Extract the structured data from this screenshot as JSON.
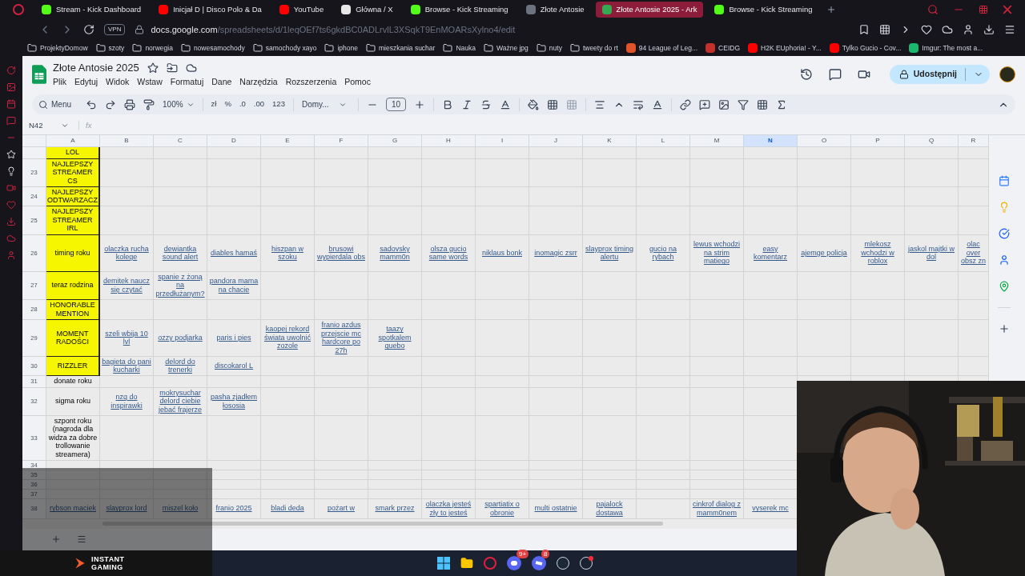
{
  "browser": {
    "tabs": [
      {
        "title": "Stream - Kick Dashboard",
        "color": "#53fc18",
        "selected": false
      },
      {
        "title": "Inicjał D | Disco Polo & Da",
        "color": "#ff0000",
        "selected": false
      },
      {
        "title": "YouTube",
        "color": "#ff0000",
        "selected": false
      },
      {
        "title": "Główna / X",
        "color": "#e7e7e7",
        "selected": false
      },
      {
        "title": "Browse - Kick Streaming",
        "color": "#53fc18",
        "selected": false
      },
      {
        "title": "Złote Antosie",
        "color": "#6b7280",
        "selected": false
      },
      {
        "title": "Złote Antosie 2025 - Ark",
        "color": "#34a853",
        "selected": true
      },
      {
        "title": "Browse - Kick Streaming",
        "color": "#53fc18",
        "selected": false
      }
    ],
    "vpn": "VPN",
    "url_host": "docs.google.com",
    "url_path": "/spreadsheets/d/1leqOEf7ts6gkdBC0ADLrvlL3XSqkT9EnMOARsXylno4/edit",
    "bookmarks": [
      {
        "title": "ProjektyDomow",
        "kind": "folder"
      },
      {
        "title": "szoty",
        "kind": "folder"
      },
      {
        "title": "norwegia",
        "kind": "folder"
      },
      {
        "title": "nowesamochody",
        "kind": "folder"
      },
      {
        "title": "samochody xayo",
        "kind": "folder"
      },
      {
        "title": "iphone",
        "kind": "folder"
      },
      {
        "title": "mieszkania suchar",
        "kind": "folder"
      },
      {
        "title": "Nauka",
        "kind": "folder"
      },
      {
        "title": "Ważne jpg",
        "kind": "folder"
      },
      {
        "title": "nuty",
        "kind": "folder"
      },
      {
        "title": "tweety do rt",
        "kind": "folder"
      },
      {
        "title": "94 League of Leg...",
        "kind": "site",
        "color": "#e0532b"
      },
      {
        "title": "CEIDG",
        "kind": "site",
        "color": "#c4302b"
      },
      {
        "title": "H2K EUphoria! - Y...",
        "kind": "site",
        "color": "#ff0000"
      },
      {
        "title": "Tylko Gucio - Cov...",
        "kind": "site",
        "color": "#ff0000"
      },
      {
        "title": "Imgur: The most a...",
        "kind": "site",
        "color": "#1bb76e"
      }
    ]
  },
  "sheet": {
    "title": "Złote Antosie 2025",
    "menu": [
      "Plik",
      "Edytuj",
      "Widok",
      "Wstaw",
      "Formatuj",
      "Dane",
      "Narzędzia",
      "Rozszerzenia",
      "Pomoc"
    ],
    "share": "Udostępnij",
    "toolbar": {
      "search": "Menu",
      "zoom": "100%",
      "currency": "zł",
      "percent": "%",
      "decrease_decimals": ".0",
      "increase_decimals": ".00",
      "number_format": "123",
      "font": "Domy...",
      "font_size": "10"
    },
    "name_box": "N42",
    "formula_label": "fx",
    "columns": [
      {
        "letter": "A",
        "selected": false
      },
      {
        "letter": "B",
        "selected": false
      },
      {
        "letter": "C",
        "selected": false
      },
      {
        "letter": "D",
        "selected": false
      },
      {
        "letter": "E",
        "selected": false
      },
      {
        "letter": "F",
        "selected": false
      },
      {
        "letter": "G",
        "selected": false
      },
      {
        "letter": "H",
        "selected": false
      },
      {
        "letter": "I",
        "selected": false
      },
      {
        "letter": "J",
        "selected": false
      },
      {
        "letter": "K",
        "selected": false
      },
      {
        "letter": "L",
        "selected": false
      },
      {
        "letter": "M",
        "selected": false
      },
      {
        "letter": "N",
        "selected": true
      },
      {
        "letter": "O",
        "selected": false
      },
      {
        "letter": "P",
        "selected": false
      },
      {
        "letter": "Q",
        "selected": false
      },
      {
        "letter": "R",
        "selected": false
      }
    ],
    "rows": [
      {
        "highlight": true,
        "cells": [
          {
            "text": "LOL",
            "link": false
          }
        ]
      },
      {
        "number": "23",
        "highlight": true,
        "cells": [
          {
            "text": "NAJLEPSZY STREAMER CS",
            "link": false
          }
        ]
      },
      {
        "number": "24",
        "highlight": true,
        "cells": [
          {
            "text": "NAJLEPSZY ODTWARZACZ",
            "link": false
          }
        ]
      },
      {
        "number": "25",
        "highlight": true,
        "cells": [
          {
            "text": "NAJLEPSZY STREAMER IRL",
            "link": false
          }
        ]
      },
      {
        "number": "26",
        "highlight": true,
        "cells": [
          {
            "text": "timing roku",
            "link": false
          },
          {
            "text": "olaczka rucha kolege",
            "link": true
          },
          {
            "text": "dewiantka sound alert",
            "link": true
          },
          {
            "text": "diables hamaś",
            "link": true
          },
          {
            "text": "hiszpan w szoku",
            "link": true
          },
          {
            "text": "brusowi wypierdala obs",
            "link": true
          },
          {
            "text": "sadovsky mamm0n",
            "link": true
          },
          {
            "text": "olsza gucio same words",
            "link": true
          },
          {
            "text": "niklaus bonk",
            "link": true
          },
          {
            "text": "inomagic zsrr",
            "link": true
          },
          {
            "text": "slayprox timing alertu",
            "link": true
          },
          {
            "text": "gucio na rybach",
            "link": true
          },
          {
            "text": "lewus wchodzi na strim matiego",
            "link": true
          },
          {
            "text": "easy komentarz",
            "link": true
          },
          {
            "text": "ajemge policja",
            "link": true
          },
          {
            "text": "mlekosz wchodzi w roblox",
            "link": true
          },
          {
            "text": "jaskol majtki w dol",
            "link": true
          },
          {
            "text": "olac over obsz zn",
            "link": true
          }
        ]
      },
      {
        "number": "27",
        "highlight": true,
        "cells": [
          {
            "text": "teraz rodzina",
            "link": false
          },
          {
            "text": "demitek naucz się czytać",
            "link": true
          },
          {
            "text": "spanie z żoną na przedłużanym?",
            "link": true
          },
          {
            "text": "pandora mama na chacie",
            "link": true
          }
        ]
      },
      {
        "number": "28",
        "highlight": true,
        "cells": [
          {
            "text": "HONORABLE MENTION",
            "link": false
          }
        ]
      },
      {
        "number": "29",
        "highlight": true,
        "cells": [
          {
            "text": "MOMENT RADOŚCI",
            "link": false
          },
          {
            "text": "szeli wbija 10 lvl",
            "link": true
          },
          {
            "text": "ozzy podjarka",
            "link": true
          },
          {
            "text": "paris i pies",
            "link": true
          },
          {
            "text": "kaopej rekord świata uwolnić zozole",
            "link": true
          },
          {
            "text": "franio azdus przejscie mc hardcore po 27h",
            "link": true
          },
          {
            "text": "taazy spotkalem quebo",
            "link": true
          }
        ]
      },
      {
        "number": "30",
        "highlight": true,
        "cells": [
          {
            "text": "RIZZLER",
            "link": false
          },
          {
            "text": "bagieta do pani kucharki",
            "link": true
          },
          {
            "text": "delord do trenerki",
            "link": true
          },
          {
            "text": "discokarol L",
            "link": true
          }
        ]
      },
      {
        "number": "31",
        "highlight": false,
        "cells": [
          {
            "text": "donate roku",
            "link": false
          }
        ]
      },
      {
        "number": "32",
        "highlight": false,
        "cells": [
          {
            "text": "sigma roku",
            "link": false
          },
          {
            "text": "nzq do inspirawki",
            "link": true
          },
          {
            "text": "mokrysuchar delord ciebie jebać frajerze",
            "link": true
          },
          {
            "text": "pasha zjadłem łososia",
            "link": true
          }
        ]
      },
      {
        "number": "33",
        "highlight": false,
        "cells": [
          {
            "text": "szpont roku (nagroda dla widza za dobre trollowanie streamera)",
            "link": false
          }
        ]
      },
      {
        "number": "34",
        "highlight": false,
        "cells": []
      },
      {
        "number": "35",
        "highlight": false,
        "cells": []
      },
      {
        "number": "36",
        "highlight": false,
        "cells": []
      },
      {
        "number": "37",
        "highlight": false,
        "cells": []
      },
      {
        "number": "38",
        "highlight": false,
        "cells": [
          {
            "text": "rybson maciek",
            "link": true
          },
          {
            "text": "slayprox lord",
            "link": true
          },
          {
            "text": "miszel koło",
            "link": true
          },
          {
            "text": "franio 2025",
            "link": true
          },
          {
            "text": "bladi deda",
            "link": true
          },
          {
            "text": "pożart w",
            "link": true
          },
          {
            "text": "smark przez",
            "link": true
          },
          {
            "text": "olaczka jesteś zły to jesteś",
            "link": true
          },
          {
            "text": "spartiatix o obronie",
            "link": true
          },
          {
            "text": "multi ostatnie",
            "link": true
          },
          {
            "text": "pajalock dostawa",
            "link": true
          },
          null,
          {
            "text": "cinkrof dialog z mamm0nem",
            "link": true
          },
          {
            "text": "vyserek mc",
            "link": true
          }
        ]
      }
    ]
  },
  "stream": {
    "brand": "INSTANT GAMING",
    "taskbar_badges": [
      {
        "kind": "discord",
        "badge": "9+"
      },
      {
        "kind": "messenger",
        "badge": "8"
      }
    ]
  }
}
